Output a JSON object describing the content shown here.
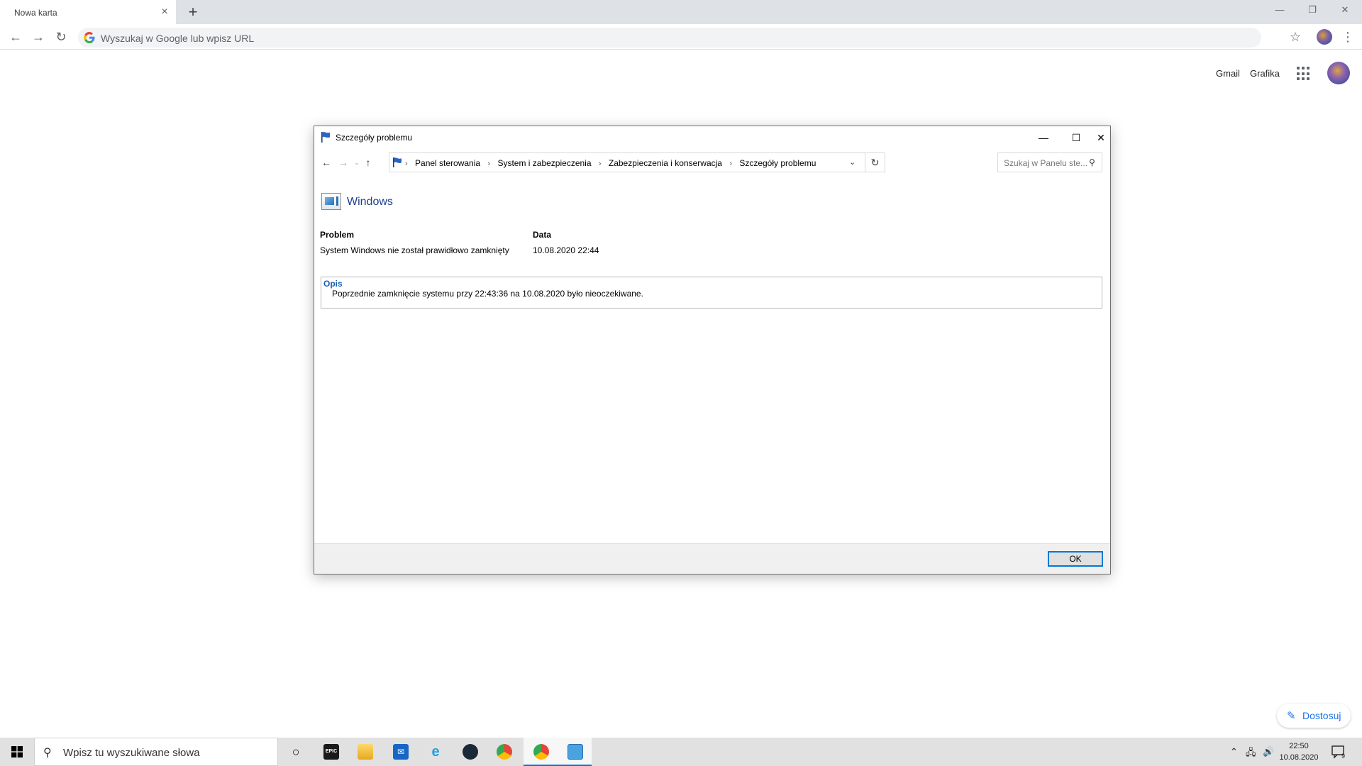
{
  "browser": {
    "tab_title": "Nowa karta",
    "omnibox_placeholder": "Wyszukaj w Google lub wpisz URL",
    "links": {
      "gmail": "Gmail",
      "images": "Grafika"
    },
    "customize_label": "Dostosuj"
  },
  "dialog": {
    "title": "Szczegóły problemu",
    "breadcrumb": [
      "Panel sterowania",
      "System i zabezpieczenia",
      "Zabezpieczenia i konserwacja",
      "Szczegóły problemu"
    ],
    "search_placeholder": "Szukaj w Panelu ste...",
    "app_name": "Windows",
    "problem_label": "Problem",
    "problem_value": "System Windows nie został prawidłowo zamknięty",
    "date_label": "Data",
    "date_value": "10.08.2020 22:44",
    "description_label": "Opis",
    "description_text": "Poprzednie zamknięcie systemu przy 22:43:36 na 10.08.2020 było nieoczekiwane.",
    "ok_label": "OK"
  },
  "taskbar": {
    "search_placeholder": "Wpisz tu wyszukiwane słowa",
    "time": "22:50",
    "date": "10.08.2020",
    "notification_count": "9",
    "apps": [
      {
        "name": "cortana",
        "glyph": "○"
      },
      {
        "name": "epic-games",
        "glyph": "EPIC"
      },
      {
        "name": "file-explorer",
        "glyph": ""
      },
      {
        "name": "mail",
        "glyph": ""
      },
      {
        "name": "internet-explorer",
        "glyph": "e"
      },
      {
        "name": "steam",
        "glyph": ""
      },
      {
        "name": "chrome",
        "glyph": ""
      },
      {
        "name": "chrome-profile",
        "glyph": ""
      },
      {
        "name": "control-panel",
        "glyph": ""
      }
    ]
  },
  "colors": {
    "accent": "#0078d7",
    "link_blue": "#1a5fb4",
    "chrome_blue": "#1a73e8"
  }
}
